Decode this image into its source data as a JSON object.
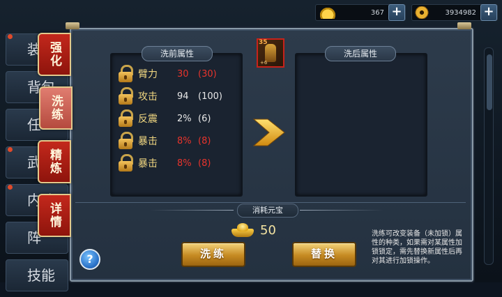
{
  "topbar": {
    "ingot_value": "367",
    "coin_value": "3934982",
    "plus_label": "+"
  },
  "side_menu": [
    "装",
    "背包",
    "任",
    "武",
    "内功",
    "阵",
    "技能"
  ],
  "tabs": [
    {
      "label": "强化",
      "active": false
    },
    {
      "label": "洗练",
      "active": true
    },
    {
      "label": "精炼",
      "active": false
    },
    {
      "label": "详情",
      "active": false
    }
  ],
  "item": {
    "level": "35",
    "sub": "+6"
  },
  "before": {
    "title": "洗前属性",
    "rows": [
      {
        "name": "臂力",
        "value": "30",
        "max": "(30)",
        "color": "red"
      },
      {
        "name": "攻击",
        "value": "94",
        "max": "(100)",
        "color": "white"
      },
      {
        "name": "反震",
        "value": "2%",
        "max": "(6)",
        "color": "white"
      },
      {
        "name": "暴击",
        "value": "8%",
        "max": "(8)",
        "color": "red"
      },
      {
        "name": "暴击",
        "value": "8%",
        "max": "(8)",
        "color": "red"
      }
    ]
  },
  "after": {
    "title": "洗后属性"
  },
  "cost": {
    "title": "消耗元宝",
    "amount": "50"
  },
  "buttons": {
    "wash": "洗练",
    "replace": "替换",
    "help": "?"
  },
  "note": "洗练可改变装备（未加锁）属性的种类，如果需对某属性加锁锁定，需先替换新属性后再对其进行加锁操作。",
  "colors": {
    "red": "#e8342c",
    "gold": "#f0d680",
    "tab": "#c3281c"
  }
}
